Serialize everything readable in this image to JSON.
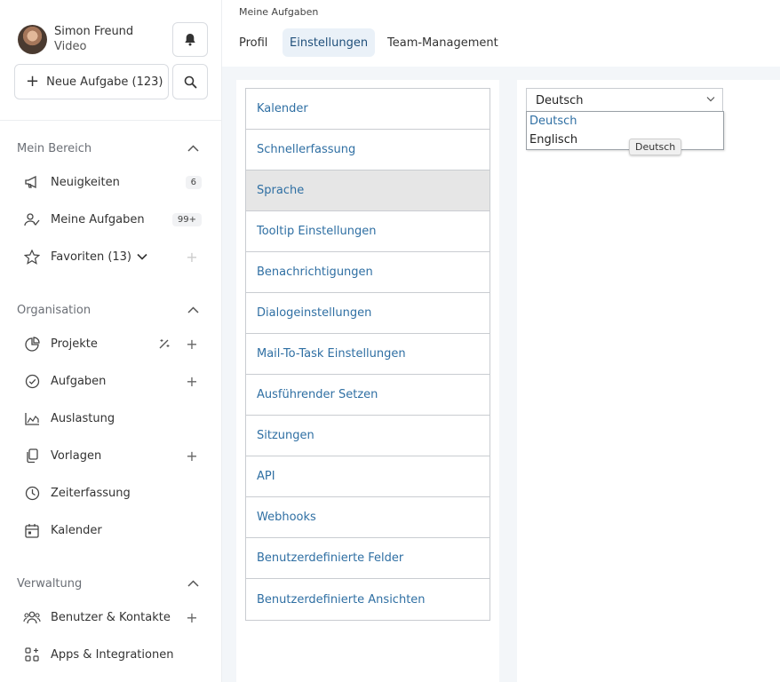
{
  "user": {
    "name": "Simon Freund",
    "subtitle": "Video"
  },
  "new_task_label": "Neue Aufgabe (123)",
  "sections": {
    "mein_bereich": {
      "title": "Mein Bereich",
      "items": [
        {
          "label": "Neuigkeiten",
          "badge": "6"
        },
        {
          "label": "Meine Aufgaben",
          "badge": "99+"
        },
        {
          "label": "Favoriten (13)",
          "add": "+"
        }
      ]
    },
    "organisation": {
      "title": "Organisation",
      "items": [
        {
          "label": "Projekte",
          "add": "+"
        },
        {
          "label": "Aufgaben",
          "add": "+"
        },
        {
          "label": "Auslastung"
        },
        {
          "label": "Vorlagen",
          "add": "+"
        },
        {
          "label": "Zeiterfassung"
        },
        {
          "label": "Kalender"
        }
      ]
    },
    "verwaltung": {
      "title": "Verwaltung",
      "items": [
        {
          "label": "Benutzer & Kontakte",
          "add": "+"
        },
        {
          "label": "Apps & Integrationen"
        }
      ]
    }
  },
  "breadcrumb": "Meine Aufgaben",
  "tabs": [
    "Profil",
    "Einstellungen",
    "Team-Management"
  ],
  "settings_menu": [
    "Kalender",
    "Schnellerfassung",
    "Sprache",
    "Tooltip Einstellungen",
    "Benachrichtigungen",
    "Dialogeinstellungen",
    "Mail-To-Task Einstellungen",
    "Ausführender Setzen",
    "Sitzungen",
    "API",
    "Webhooks",
    "Benutzerdefinierte Felder",
    "Benutzerdefinierte Ansichten"
  ],
  "language": {
    "selected": "Deutsch",
    "options": [
      "Deutsch",
      "Englisch"
    ],
    "tooltip": "Deutsch"
  },
  "colors": {
    "accent": "#2f6fa3",
    "active_tab_bg": "#eaf1f8",
    "content_bg": "#f3f6f9"
  }
}
